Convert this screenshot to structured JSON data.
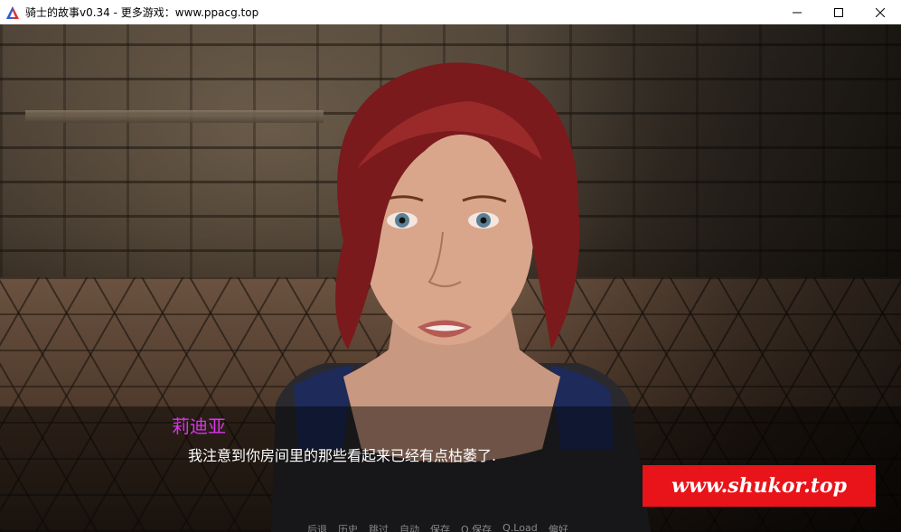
{
  "window": {
    "title": "骑士的故事v0.34 - 更多游戏：www.ppacg.top",
    "controls": {
      "minimize_icon": "minimize-icon",
      "maximize_icon": "maximize-icon",
      "close_icon": "close-icon"
    }
  },
  "dialogue": {
    "speaker": "莉迪亚",
    "text": "我注意到你房间里的那些看起来已经有点枯萎了.",
    "speaker_color": "#d935e8"
  },
  "quick_menu": {
    "items": [
      "后退",
      "历史",
      "跳过",
      "自动",
      "保存",
      "Q.保存",
      "Q.Load",
      "偏好"
    ]
  },
  "watermark": {
    "text": "www.shukor.top",
    "background": "#e8141a"
  },
  "colors": {
    "app_icon_red": "#e0312b",
    "app_icon_blue": "#2b5fd9"
  }
}
